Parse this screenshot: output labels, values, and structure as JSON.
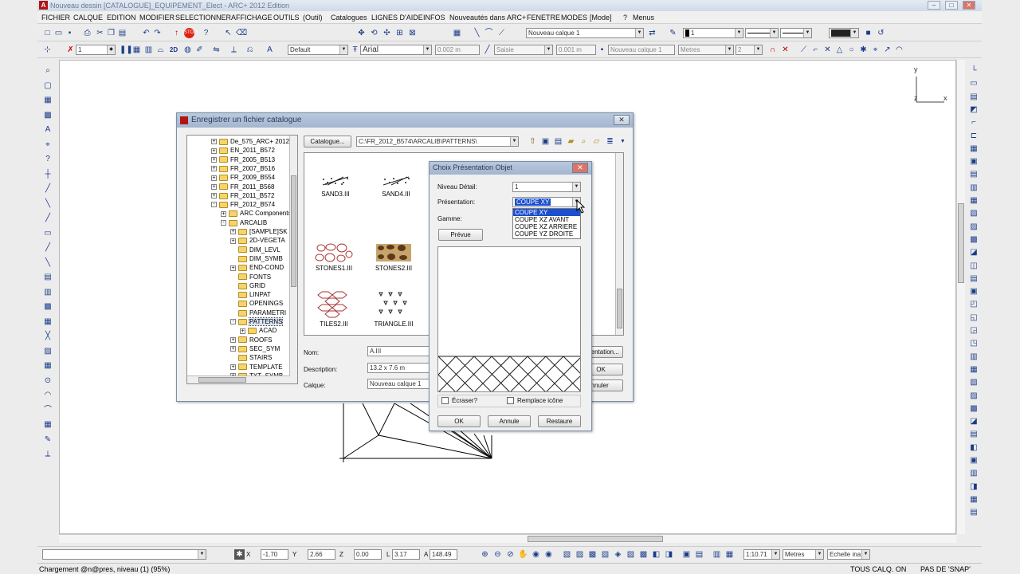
{
  "window": {
    "title": "Nouveau dessin [CATALOGUE]_EQUIPEMENT_Elect - ARC+ 2012 Edition"
  },
  "menu": [
    "FICHIER",
    "CALQUE",
    "EDITION",
    "MODIFIER",
    "SELECTIONNER",
    "AFFICHAGE",
    "OUTILS",
    "(Outil)",
    "Catalogues",
    "LIGNES D'AIDE",
    "INFOS",
    "Nouveautés dans ARC+",
    "FENETRE",
    "MODES",
    "[Mode]",
    "?",
    "Menus"
  ],
  "toolbar1": {
    "layer_field": "Nouveau calque 1",
    "color_field": "1"
  },
  "toolbar2": {
    "scale_field": "1",
    "zoom_label": "2D",
    "style_field": "Default",
    "font_field": "Arial",
    "height_field": "0.002 m",
    "pen_field": "Saisie",
    "width_field": "0.001 m",
    "layer_field": "Nouveau calque 1",
    "units_field": "Metres",
    "decimals_field": "2"
  },
  "axis": {
    "y": "y",
    "x": "x",
    "z": "z"
  },
  "catalog_dialog": {
    "title": "Enregistrer un fichier catalogue",
    "catalogue_button": "Catalogue...",
    "path": "C:\\FR_2012_B574\\ARCALIB\\PATTERNS\\",
    "tree": [
      {
        "label": "De_575_ARC+ 2012",
        "expand": "+",
        "level": 0
      },
      {
        "label": "EN_2011_B572",
        "expand": "+",
        "level": 0
      },
      {
        "label": "FR_2005_B513",
        "expand": "+",
        "level": 0
      },
      {
        "label": "FR_2007_B516",
        "expand": "+",
        "level": 0
      },
      {
        "label": "FR_2009_B554",
        "expand": "+",
        "level": 0
      },
      {
        "label": "FR_2011_B568",
        "expand": "+",
        "level": 0
      },
      {
        "label": "FR_2011_B572",
        "expand": "+",
        "level": 0
      },
      {
        "label": "FR_2012_B574",
        "expand": "-",
        "level": 0
      },
      {
        "label": "ARC Components",
        "expand": "+",
        "level": 1
      },
      {
        "label": "ARCALIB",
        "expand": "-",
        "level": 1
      },
      {
        "label": "[SAMPLE]SK",
        "expand": "+",
        "level": 2
      },
      {
        "label": "2D-VEGETA",
        "expand": "+",
        "level": 2
      },
      {
        "label": "DIM_LEVL",
        "expand": "",
        "level": 2
      },
      {
        "label": "DIM_SYMB",
        "expand": "",
        "level": 2
      },
      {
        "label": "END-COND",
        "expand": "+",
        "level": 2
      },
      {
        "label": "FONTS",
        "expand": "",
        "level": 2
      },
      {
        "label": "GRID",
        "expand": "",
        "level": 2
      },
      {
        "label": "LINPAT",
        "expand": "",
        "level": 2
      },
      {
        "label": "OPENINGS",
        "expand": "",
        "level": 2
      },
      {
        "label": "PARAMETRI",
        "expand": "",
        "level": 2
      },
      {
        "label": "PATTERNS",
        "expand": "-",
        "level": 2,
        "selected": true
      },
      {
        "label": "ACAD",
        "expand": "+",
        "level": 3
      },
      {
        "label": "ROOFS",
        "expand": "+",
        "level": 2
      },
      {
        "label": "SEC_SYM",
        "expand": "+",
        "level": 2
      },
      {
        "label": "STAIRS",
        "expand": "",
        "level": 2
      },
      {
        "label": "TEMPLATE",
        "expand": "+",
        "level": 2
      },
      {
        "label": "TXT_SYMB",
        "expand": "+",
        "level": 2
      }
    ],
    "thumbnails": [
      "SAND3.III",
      "SAND4.III",
      "STONES1.III",
      "STONES2.III",
      "TILES2.III",
      "TRIANGLE.III"
    ],
    "name_label": "Nom:",
    "name_value": "A.III",
    "description_label": "Description:",
    "description_value": "13.2 x 7.6 m",
    "layer_label": "Calque:",
    "layer_value": "Nouveau calque 1",
    "presentation_button": "Présentation...",
    "ok_button": "OK",
    "cancel_button": "Annuler"
  },
  "presentation_dialog": {
    "title": "Choix Présentation Objet",
    "detail_label": "Niveau Détail:",
    "detail_value": "1",
    "presentation_label": "Présentation:",
    "presentation_value": "COUPE XY",
    "options": [
      "COUPE XY",
      "COUPE XZ AVANT",
      "COUPE XZ ARRIERE",
      "COUPE YZ DROITE"
    ],
    "range_label": "Gamme:",
    "preview_button": "Prévue",
    "overwrite_label": "Écraser?",
    "replace_icon_label": "Remplace icône",
    "ok_button": "OK",
    "cancel_button": "Annule",
    "restore_button": "Restaure"
  },
  "coords": {
    "x_label": "X",
    "x_value": "-1.70",
    "y_label": "Y",
    "y_value": "2.66",
    "z_label": "Z",
    "z_value": "0.00",
    "l_label": "L",
    "l_value": "3.17",
    "angle_label": "A",
    "angle_value": "148.49",
    "scale_value": "1:10.71",
    "units_value": "Metres",
    "scale_mode": "Echelle ina"
  },
  "status": {
    "message": "Chargement @n@pres, niveau (1) (95%)",
    "layers": "TOUS CALQ. ON",
    "snap": "PAS DE 'SNAP'"
  }
}
